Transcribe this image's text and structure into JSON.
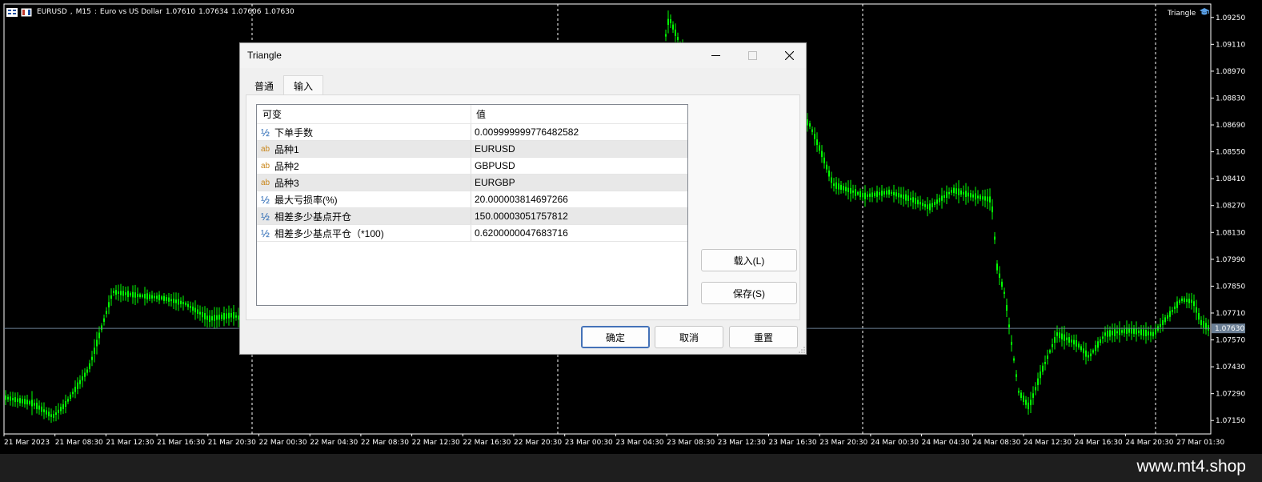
{
  "chart": {
    "symbol": "EURUSD",
    "timeframe": "M15",
    "description": "Euro vs US Dollar",
    "ohlc": [
      "1.07610",
      "1.07634",
      "1.07606",
      "1.07630"
    ],
    "ea_name": "Triangle",
    "current_price": "1.07630",
    "price_ticks": [
      "1.09250",
      "1.09110",
      "1.08970",
      "1.08830",
      "1.08690",
      "1.08550",
      "1.08410",
      "1.08270",
      "1.08130",
      "1.07990",
      "1.07850",
      "1.07710",
      "1.07570",
      "1.07430",
      "1.07290",
      "1.07150"
    ],
    "time_ticks": [
      "21 Mar 2023",
      "21 Mar 08:30",
      "21 Mar 12:30",
      "21 Mar 16:30",
      "21 Mar 20:30",
      "22 Mar 00:30",
      "22 Mar 04:30",
      "22 Mar 08:30",
      "22 Mar 12:30",
      "22 Mar 16:30",
      "22 Mar 20:30",
      "23 Mar 00:30",
      "23 Mar 04:30",
      "23 Mar 08:30",
      "23 Mar 12:30",
      "23 Mar 16:30",
      "23 Mar 20:30",
      "24 Mar 00:30",
      "24 Mar 04:30",
      "24 Mar 08:30",
      "24 Mar 12:30",
      "24 Mar 16:30",
      "24 Mar 20:30",
      "27 Mar 01:30"
    ],
    "colors": {
      "background": "#000000",
      "candle": "#00ff00",
      "grid": "#ffffff",
      "price_line": "#6b7f95"
    }
  },
  "dialog": {
    "title": "Triangle",
    "tabs": [
      "普通",
      "输入"
    ],
    "active_tab": "输入",
    "grid": {
      "header_variable": "可变",
      "header_value": "值",
      "rows": [
        {
          "type": "½",
          "kind": "num",
          "name": "下单手数",
          "value": "0.009999999776482582"
        },
        {
          "type": "ab",
          "kind": "str",
          "name": "品种1",
          "value": "EURUSD"
        },
        {
          "type": "ab",
          "kind": "str",
          "name": "品种2",
          "value": "GBPUSD"
        },
        {
          "type": "ab",
          "kind": "str",
          "name": "品种3",
          "value": "EURGBP"
        },
        {
          "type": "½",
          "kind": "num",
          "name": "最大亏损率(%)",
          "value": "20.000003814697266"
        },
        {
          "type": "½",
          "kind": "num",
          "name": "相差多少基点开仓",
          "value": "150.00003051757812"
        },
        {
          "type": "½",
          "kind": "num",
          "name": "相差多少基点平仓（*100)",
          "value": "0.6200000047683716"
        }
      ]
    },
    "load_label": "载入(L)",
    "save_label": "保存(S)",
    "ok_label": "确定",
    "cancel_label": "取消",
    "reset_label": "重置"
  },
  "footer": {
    "watermark": "www.mt4.shop"
  }
}
